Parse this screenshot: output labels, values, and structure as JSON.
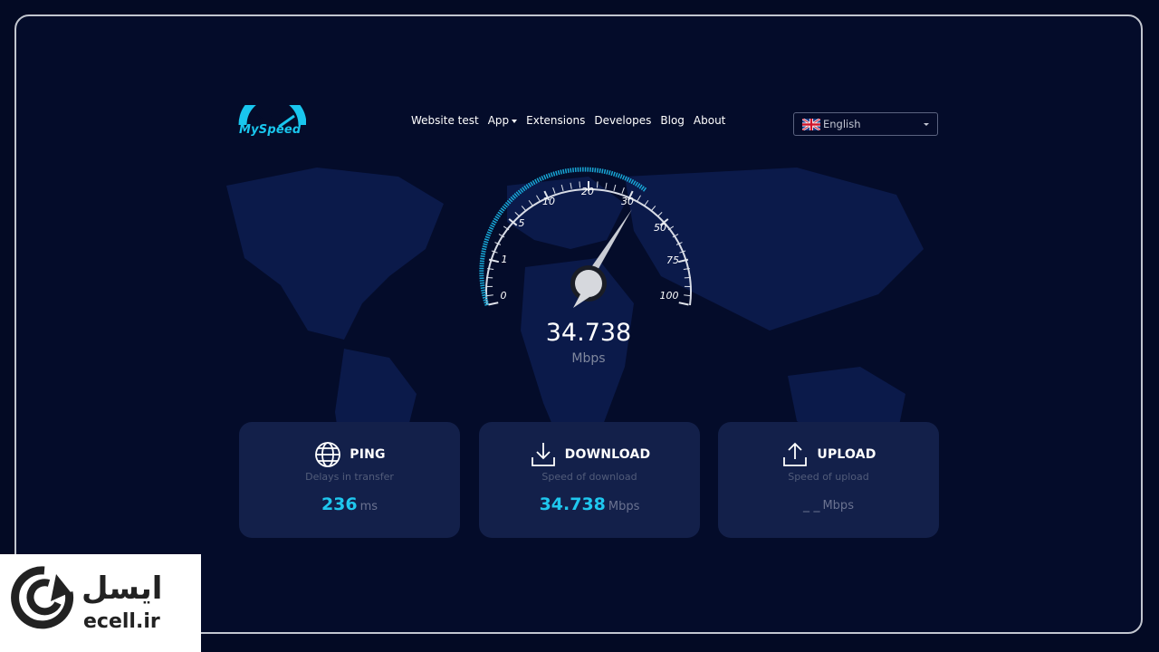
{
  "brand": {
    "name": "MySpeed",
    "color": "#19c6ee"
  },
  "nav": {
    "items": [
      "Website test",
      "App",
      "Extensions",
      "Developes",
      "Blog",
      "About"
    ]
  },
  "language": {
    "selected": "English",
    "flag": "uk-flag-icon"
  },
  "gauge": {
    "ticks": [
      "0",
      "1",
      "5",
      "10",
      "20",
      "30",
      "50",
      "75",
      "100"
    ],
    "value": "34.738",
    "unit": "Mbps"
  },
  "cards": {
    "ping": {
      "title": "PING",
      "subtitle": "Delays in transfer",
      "value": "236",
      "unit": "ms",
      "icon": "globe-icon"
    },
    "download": {
      "title": "DOWNLOAD",
      "subtitle": "Speed of download",
      "value": "34.738",
      "unit": "Mbps",
      "icon": "download-icon"
    },
    "upload": {
      "title": "UPLOAD",
      "subtitle": "Speed of upload",
      "value": "_ _",
      "unit": "Mbps",
      "icon": "upload-icon"
    }
  },
  "watermark": {
    "persian": "ایسل",
    "latin": "ecell.ir"
  }
}
